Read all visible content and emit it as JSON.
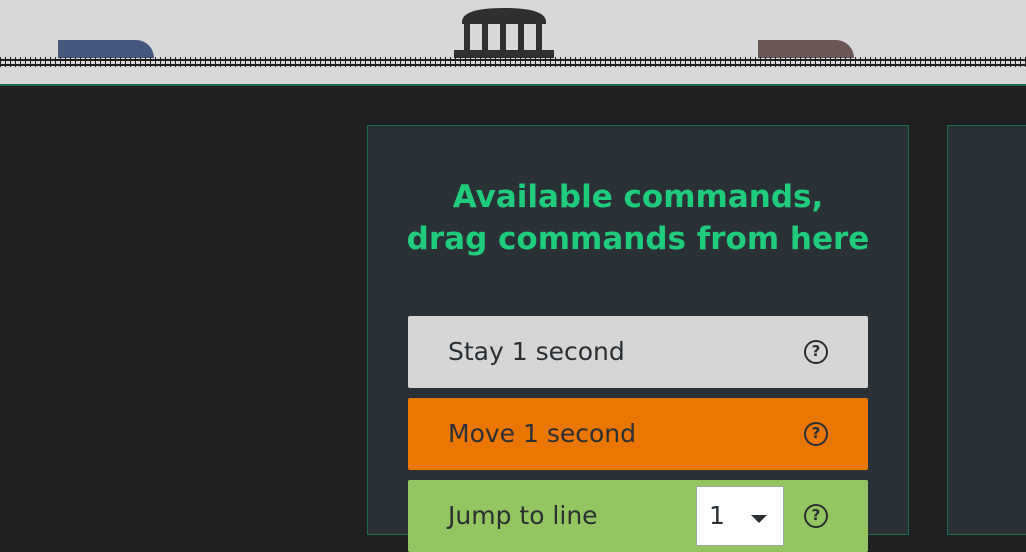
{
  "scene": {
    "train_left_color": "#44577d",
    "train_right_color": "#6b5555",
    "station_color": "#2f2f2f",
    "track_color": "#1e1e1e"
  },
  "panel": {
    "title_line1": "Available commands,",
    "title_line2": "drag commands from here",
    "title_color": "#1fcc7c"
  },
  "commands": [
    {
      "label": "Stay 1 second",
      "color": "#d6d6d6",
      "help_icon": "question-circle-icon",
      "help_glyph": "?"
    },
    {
      "label": "Move 1 second",
      "color": "#ec7700",
      "help_icon": "question-circle-icon",
      "help_glyph": "?"
    },
    {
      "label": "Jump to line",
      "color": "#93c661",
      "help_icon": "question-circle-icon",
      "help_glyph": "?",
      "line_value": "1"
    }
  ]
}
